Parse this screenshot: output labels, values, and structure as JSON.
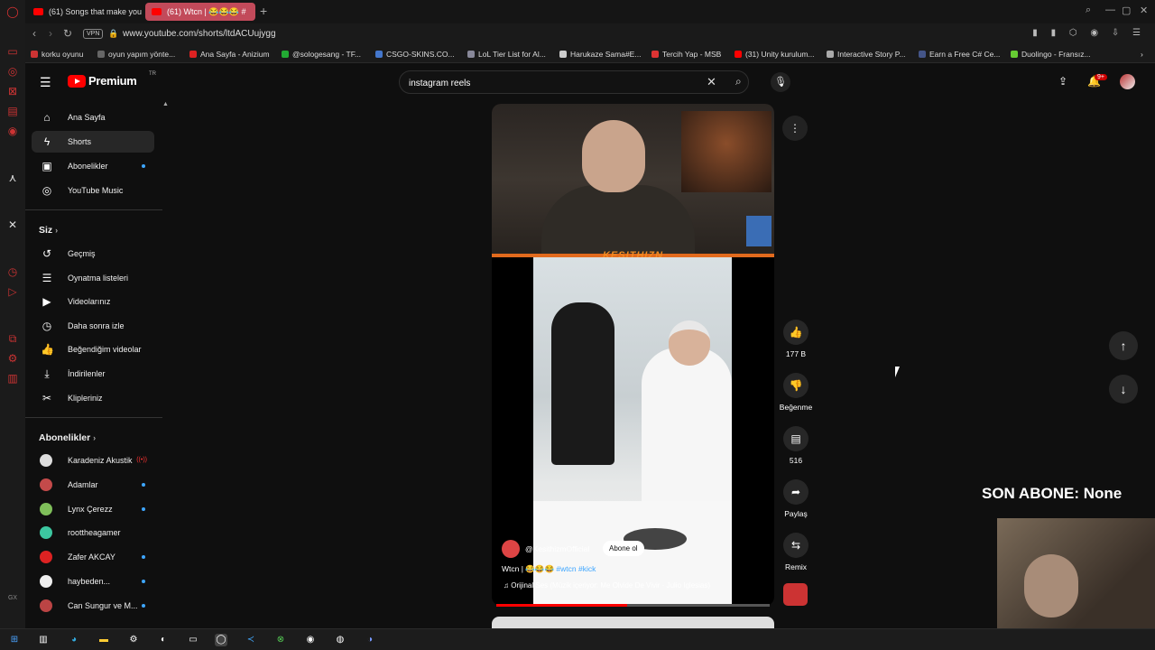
{
  "browser": {
    "tabs": [
      {
        "label": "(61) Songs that make you"
      },
      {
        "label": "(61) Wtcn | 😂😂😂 #"
      }
    ],
    "address": {
      "vpn_label": "VPN",
      "url": "www.youtube.com/shorts/ltdACUujygg"
    },
    "bookmarks": [
      "korku oyunu",
      "oyun yapım yönte...",
      "Ana Sayfa - Anizium",
      "@sologesang - TF...",
      "CSGO-SKINS.CO...",
      "LoL Tier List for Al...",
      "Harukaze Sama#E...",
      "Tercih Yap - MSB",
      "(31) Unity kurulum...",
      "Interactive Story P...",
      "Earn a Free C# Ce...",
      "Duolingo - Fransız..."
    ]
  },
  "header": {
    "logo_text": "Premium",
    "logo_region": "TR",
    "search_value": "instagram reels",
    "notif_count": "9+"
  },
  "guide": {
    "main": [
      {
        "label": "Ana Sayfa",
        "icon": "home-icon"
      },
      {
        "label": "Shorts",
        "icon": "shorts-icon"
      },
      {
        "label": "Abonelikler",
        "icon": "subscriptions-icon"
      },
      {
        "label": "YouTube Music",
        "icon": "music-icon"
      }
    ],
    "you_heading": "Siz",
    "you": [
      {
        "label": "Geçmiş"
      },
      {
        "label": "Oynatma listeleri"
      },
      {
        "label": "Videolarınız"
      },
      {
        "label": "Daha sonra izle"
      },
      {
        "label": "Beğendiğim videolar"
      },
      {
        "label": "İndirilenler"
      },
      {
        "label": "Klipleriniz"
      }
    ],
    "subs_heading": "Abonelikler",
    "subs": [
      {
        "label": "Karadeniz Akustik",
        "color": "#dddddd"
      },
      {
        "label": "Adamlar",
        "color": "#c44a4a"
      },
      {
        "label": "Lynx Çerezz",
        "color": "#7fbf5a"
      },
      {
        "label": "roottheagamer",
        "color": "#3cc7a0"
      },
      {
        "label": "Zafer AKCAY",
        "color": "#d22"
      },
      {
        "label": "haybeden...",
        "color": "#eeeeee"
      },
      {
        "label": "Can Sungur ve M...",
        "color": "#b44"
      }
    ]
  },
  "short": {
    "brand_text": "KESITHIZN",
    "channel": "@KesithizmOfficial",
    "subscribe_label": "Abone ol",
    "title": "Wtcn | 😂😂😂",
    "hashtags": "#wtcn #kick",
    "music": "Orijinal Ses (Müzik içeriyor: Me Olvide De Vivir · Julio Iglesias)",
    "progress_percent": 48,
    "actions": {
      "like_count": "177 B",
      "dislike_label": "Beğenme",
      "comment_count": "516",
      "share_label": "Paylaş",
      "remix_label": "Remix"
    }
  },
  "overlay": {
    "son_abone": "SON ABONE: None"
  }
}
